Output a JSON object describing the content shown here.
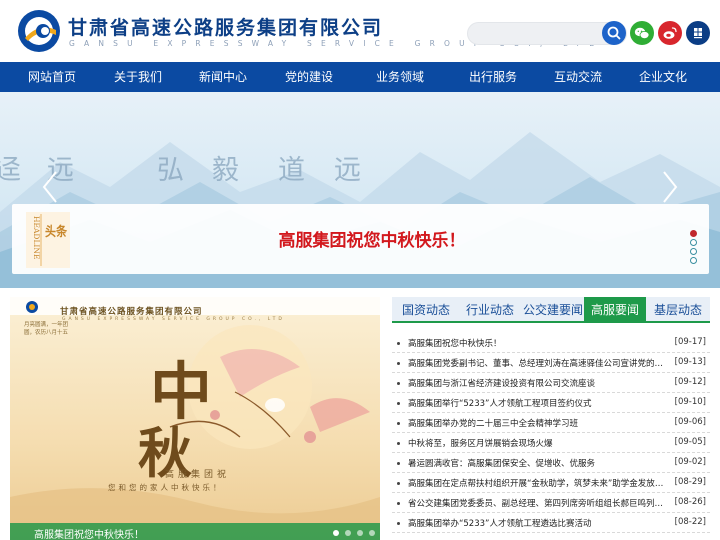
{
  "brand": {
    "name_cn": "甘肃省高速公路服务集团有限公司",
    "name_en": "GANSU EXPRESSWAY SERVICE GROUP CO., LTD"
  },
  "header": {
    "search_placeholder": "",
    "icons": [
      "search-icon",
      "wechat-icon",
      "weibo-icon",
      "app-icon"
    ]
  },
  "nav": {
    "items": [
      {
        "label": "网站首页"
      },
      {
        "label": "关于我们"
      },
      {
        "label": "新闻中心"
      },
      {
        "label": "党的建设"
      },
      {
        "label": "业务领域"
      },
      {
        "label": "出行服务"
      },
      {
        "label": "互动交流"
      },
      {
        "label": "企业文化"
      }
    ]
  },
  "banner": {
    "calligraphy": [
      "迳",
      "远",
      "弘",
      "毅",
      "道",
      "远"
    ],
    "headline_tag_en": "HEADLINE",
    "headline_tag_cn": "头条",
    "headline_text": "高服集团祝您中秋快乐！",
    "slide_count": 4,
    "active_slide": 1
  },
  "poster": {
    "company": "甘肃省高速公路服务集团有限公司",
    "company_en": "GANSU EXPRESSWAY SERVICE GROUP CO., LTD",
    "date_text": "月亮圆满，一年团圆，农历八月十五",
    "big_char_1": "中",
    "big_char_2": "秋",
    "line1": "高服集团祝",
    "line2": "您和您的家人中秋快乐！",
    "caption": "高服集团祝您中秋快乐！",
    "slide_count": 4
  },
  "news": {
    "tabs": [
      {
        "label": "国资动态"
      },
      {
        "label": "行业动态"
      },
      {
        "label": "公交建要闻"
      },
      {
        "label": "高服要闻"
      },
      {
        "label": "基层动态"
      }
    ],
    "active_tab": 3,
    "items": [
      {
        "title": "高服集团祝您中秋快乐！",
        "date": "[09-17]"
      },
      {
        "title": "高服集团党委副书记、董事、总经理刘涛在高速驿佳公司宣讲党的二十…",
        "date": "[09-13]"
      },
      {
        "title": "高服集团与浙江省经济建设投资有限公司交流座谈",
        "date": "[09-12]"
      },
      {
        "title": "高服集团举行“5233”人才领航工程项目签约仪式",
        "date": "[09-10]"
      },
      {
        "title": "高服集团举办党的二十届三中全会精神学习班",
        "date": "[09-06]"
      },
      {
        "title": "中秋将至，服务区月饼展销会现场火爆",
        "date": "[09-05]"
      },
      {
        "title": "暑运圆满收官：高服集团保安全、促增收、优服务",
        "date": "[09-02]"
      },
      {
        "title": "高服集团在定点帮扶村组织开展“金秋助学，筑梦未来”助学金发放活动",
        "date": "[08-29]"
      },
      {
        "title": "省公交建集团党委委员、副总经理、第四列席旁听组组长郝巨鸣列席旁…",
        "date": "[08-26]"
      },
      {
        "title": "高服集团举办“5233”人才领航工程遴选比赛活动",
        "date": "[08-22]"
      }
    ]
  },
  "colors": {
    "brand_blue": "#0b4aa2",
    "headline_red": "#d2181d",
    "tab_green": "#1e9a4a"
  }
}
